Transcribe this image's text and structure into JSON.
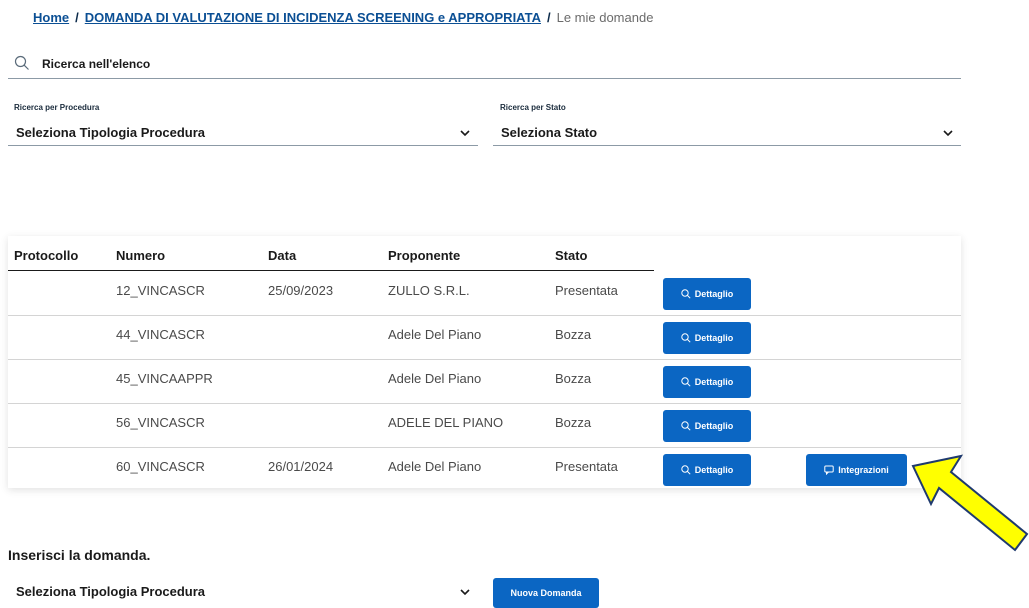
{
  "breadcrumb": {
    "home": "Home",
    "section": "DOMANDA DI VALUTAZIONE DI INCIDENZA SCREENING e APPROPRIATA",
    "separator": "/",
    "current": "Le mie domande"
  },
  "search": {
    "label": "Ricerca nell'elenco",
    "icon": "search-icon"
  },
  "filters": {
    "procedura": {
      "label": "Ricerca per Procedura",
      "value": "Seleziona Tipologia Procedura"
    },
    "stato": {
      "label": "Ricerca per Stato",
      "value": "Seleziona Stato"
    }
  },
  "table": {
    "headers": [
      "Protocollo",
      "Numero",
      "Data",
      "Proponente",
      "Stato"
    ],
    "rows": [
      {
        "protocollo": "",
        "numero": "12_VINCASCR",
        "data": "25/09/2023",
        "proponente": "ZULLO S.R.L.",
        "stato": "Presentata",
        "integrazioni": false
      },
      {
        "protocollo": "",
        "numero": "44_VINCASCR",
        "data": "",
        "proponente": "Adele Del Piano",
        "stato": "Bozza",
        "integrazioni": false
      },
      {
        "protocollo": "",
        "numero": "45_VINCAAPPR",
        "data": "",
        "proponente": "Adele Del Piano",
        "stato": "Bozza",
        "integrazioni": false
      },
      {
        "protocollo": "",
        "numero": "56_VINCASCR",
        "data": "",
        "proponente": "ADELE DEL PIANO",
        "stato": "Bozza",
        "integrazioni": false
      },
      {
        "protocollo": "",
        "numero": "60_VINCASCR",
        "data": "26/01/2024",
        "proponente": "Adele Del Piano",
        "stato": "Presentata",
        "integrazioni": true
      }
    ],
    "dettaglio_label": "Dettaglio",
    "integrazioni_label": "Integrazioni"
  },
  "insert": {
    "title": "Inserisci la domanda.",
    "select_value": "Seleziona Tipologia Procedura",
    "button_label": "Nuova Domanda"
  },
  "colors": {
    "primary": "#0b66c3",
    "link": "#0b4f94",
    "annotation_arrow": "#ffff00"
  }
}
